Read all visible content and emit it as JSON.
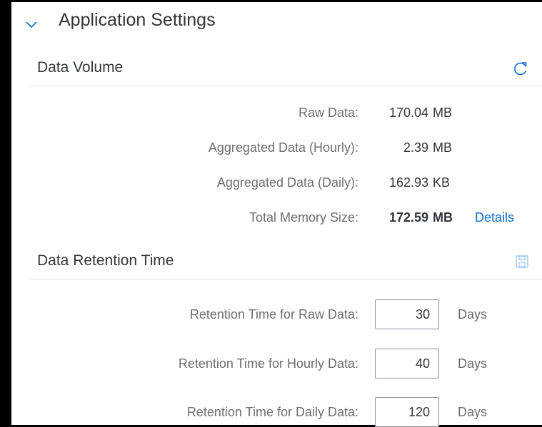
{
  "app": {
    "section_title": "Application Settings"
  },
  "data_volume": {
    "title": "Data Volume",
    "rows": [
      {
        "label": "Raw Data:",
        "value": "170.04",
        "unit": "MB"
      },
      {
        "label": "Aggregated Data (Hourly):",
        "value": "2.39",
        "unit": "MB"
      },
      {
        "label": "Aggregated Data (Daily):",
        "value": "162.93",
        "unit": "KB"
      },
      {
        "label": "Total Memory Size:",
        "value": "172.59",
        "unit": "MB",
        "link": "Details"
      }
    ]
  },
  "retention": {
    "title": "Data Retention Time",
    "rows": [
      {
        "label": "Retention Time for Raw Data:",
        "value": "30",
        "unit": "Days"
      },
      {
        "label": "Retention Time for Hourly Data:",
        "value": "40",
        "unit": "Days"
      },
      {
        "label": "Retention Time for Daily Data:",
        "value": "120",
        "unit": "Days"
      }
    ]
  },
  "icons": {
    "expand": "chevron-down-icon",
    "refresh": "refresh-icon",
    "save": "save-icon"
  },
  "colors": {
    "link": "#0a6ed1",
    "text": "#32363a",
    "label": "#6a6d70",
    "border": "#89919a"
  }
}
